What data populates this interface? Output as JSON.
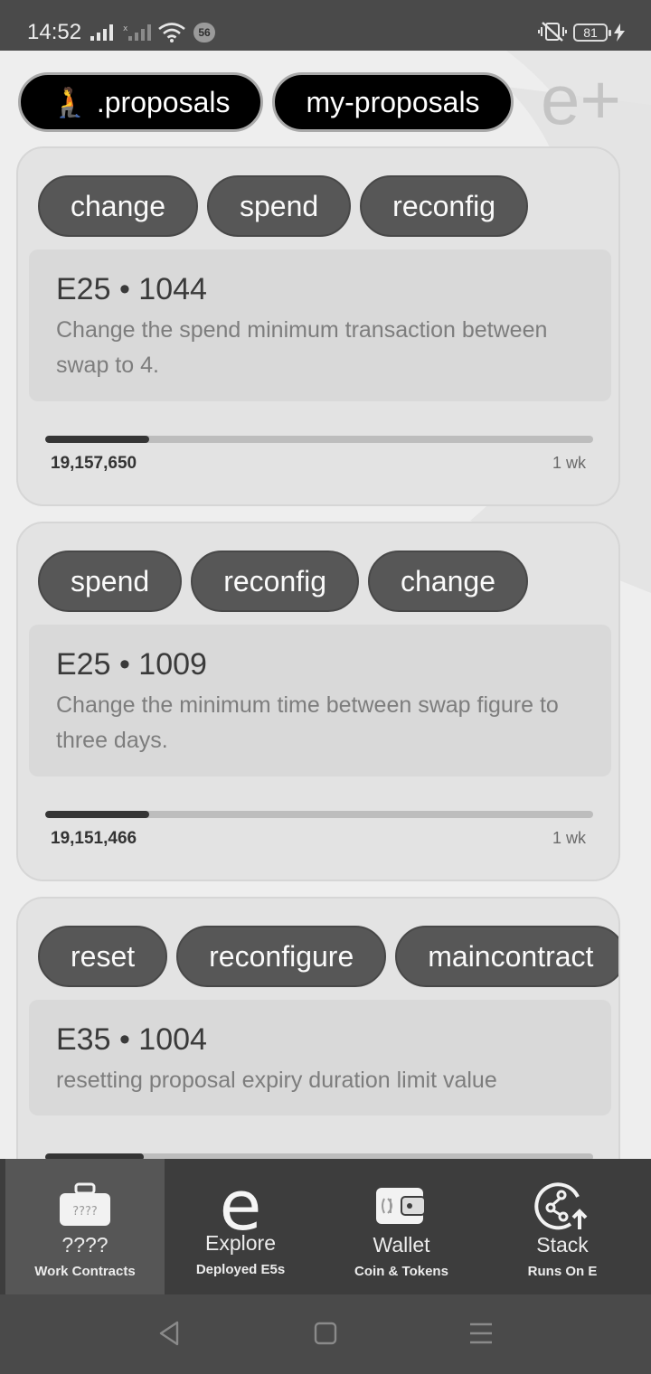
{
  "status": {
    "time": "14:52",
    "notification_count": "56",
    "battery": "81"
  },
  "header": {
    "tabs": [
      {
        "emoji": "🧎",
        "label": ".proposals"
      },
      {
        "label": "my-proposals"
      }
    ],
    "logo_text": "e+"
  },
  "proposals": [
    {
      "tags": [
        "change",
        "spend",
        "reconfig"
      ],
      "id": "E25 • 1044",
      "description": "Change the spend minimum transaction between swap to 4.",
      "votes": "19,157,650",
      "progress": 0.19,
      "time_left": "1 wk"
    },
    {
      "tags": [
        "spend",
        "reconfig",
        "change"
      ],
      "id": "E25 • 1009",
      "description": "Change the minimum time between swap figure to three days.",
      "votes": "19,151,466",
      "progress": 0.19,
      "time_left": "1 wk"
    },
    {
      "tags": [
        "reset",
        "reconfigure",
        "maincontract"
      ],
      "id": "E35 • 1004",
      "description": "resetting proposal expiry duration limit value",
      "progress": 0.18
    }
  ],
  "bottom_nav": [
    {
      "icon": "briefcase-icon",
      "icon_text": "????",
      "title": "????",
      "subtitle": "Work Contracts"
    },
    {
      "icon": "e-logo-icon",
      "icon_text": "e",
      "title": "Explore",
      "subtitle": "Deployed E5s"
    },
    {
      "icon": "wallet-icon",
      "title": "Wallet",
      "subtitle": "Coin & Tokens"
    },
    {
      "icon": "stack-icon",
      "title": "Stack",
      "subtitle": "Runs On E"
    }
  ]
}
